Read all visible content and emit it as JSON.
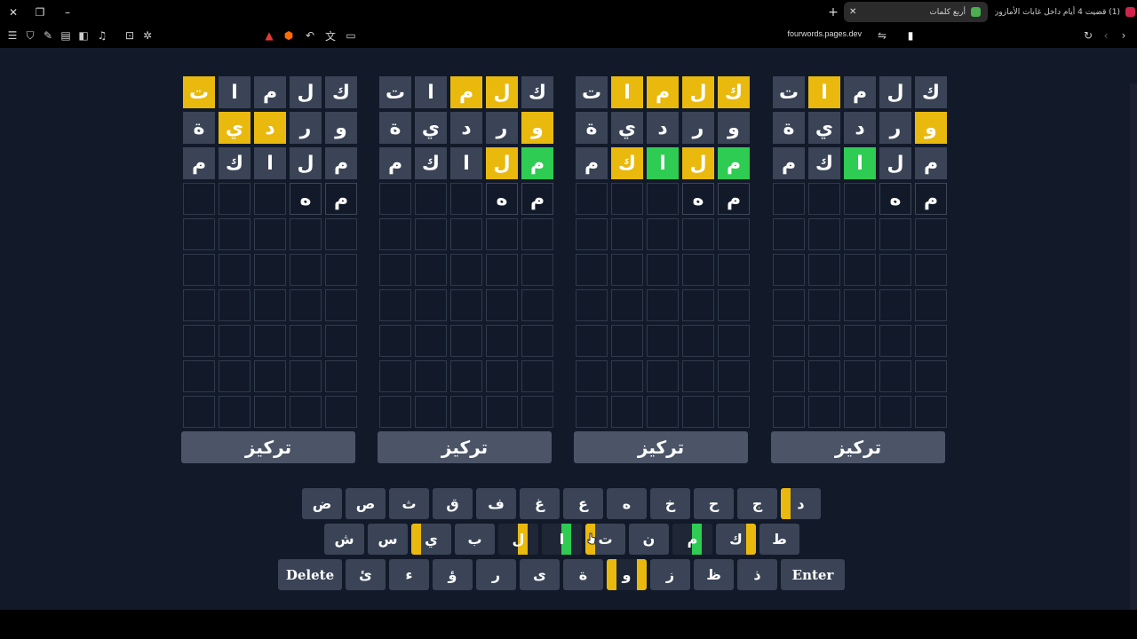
{
  "browser": {
    "tabs": [
      {
        "title": "(1) قضيت 4 أيام داخل غابات الأمازون !",
        "active": false,
        "favicon_color": "#d0244a"
      },
      {
        "title": "أربع كلمات",
        "active": true,
        "favicon_color": "#4caf50"
      }
    ],
    "url": "fourwords.pages.dev",
    "new_tab_label": "+"
  },
  "game": {
    "colors": {
      "gray": "#3a4456",
      "yellow": "#e9b90e",
      "green": "#2ecc52",
      "background": "#121a2a"
    },
    "boards": [
      {
        "focus_label": "تركيز",
        "rows": [
          [
            {
              "l": "ك",
              "s": "gray"
            },
            {
              "l": "ل",
              "s": "gray"
            },
            {
              "l": "م",
              "s": "gray"
            },
            {
              "l": "ا",
              "s": "gray"
            },
            {
              "l": "ت",
              "s": "yellow"
            }
          ],
          [
            {
              "l": "و",
              "s": "gray"
            },
            {
              "l": "ر",
              "s": "gray"
            },
            {
              "l": "د",
              "s": "yellow"
            },
            {
              "l": "ي",
              "s": "yellow"
            },
            {
              "l": "ة",
              "s": "gray"
            }
          ],
          [
            {
              "l": "م",
              "s": "gray"
            },
            {
              "l": "ل",
              "s": "gray"
            },
            {
              "l": "ا",
              "s": "gray"
            },
            {
              "l": "ك",
              "s": "gray"
            },
            {
              "l": "م",
              "s": "gray"
            }
          ],
          [
            {
              "l": "م",
              "s": "typed"
            },
            {
              "l": "ه",
              "s": "typed"
            },
            {
              "l": "",
              "s": "empty"
            },
            {
              "l": "",
              "s": "empty"
            },
            {
              "l": "",
              "s": "empty"
            }
          ]
        ]
      },
      {
        "focus_label": "تركيز",
        "rows": [
          [
            {
              "l": "ك",
              "s": "gray"
            },
            {
              "l": "ل",
              "s": "yellow"
            },
            {
              "l": "م",
              "s": "yellow"
            },
            {
              "l": "ا",
              "s": "gray"
            },
            {
              "l": "ت",
              "s": "gray"
            }
          ],
          [
            {
              "l": "و",
              "s": "yellow"
            },
            {
              "l": "ر",
              "s": "gray"
            },
            {
              "l": "د",
              "s": "gray"
            },
            {
              "l": "ي",
              "s": "gray"
            },
            {
              "l": "ة",
              "s": "gray"
            }
          ],
          [
            {
              "l": "م",
              "s": "green"
            },
            {
              "l": "ل",
              "s": "yellow"
            },
            {
              "l": "ا",
              "s": "gray"
            },
            {
              "l": "ك",
              "s": "gray"
            },
            {
              "l": "م",
              "s": "gray"
            }
          ],
          [
            {
              "l": "م",
              "s": "typed"
            },
            {
              "l": "ه",
              "s": "typed"
            },
            {
              "l": "",
              "s": "empty"
            },
            {
              "l": "",
              "s": "empty"
            },
            {
              "l": "",
              "s": "empty"
            }
          ]
        ]
      },
      {
        "focus_label": "تركيز",
        "rows": [
          [
            {
              "l": "ك",
              "s": "yellow"
            },
            {
              "l": "ل",
              "s": "yellow"
            },
            {
              "l": "م",
              "s": "yellow"
            },
            {
              "l": "ا",
              "s": "yellow"
            },
            {
              "l": "ت",
              "s": "gray"
            }
          ],
          [
            {
              "l": "و",
              "s": "gray"
            },
            {
              "l": "ر",
              "s": "gray"
            },
            {
              "l": "د",
              "s": "gray"
            },
            {
              "l": "ي",
              "s": "gray"
            },
            {
              "l": "ة",
              "s": "gray"
            }
          ],
          [
            {
              "l": "م",
              "s": "green"
            },
            {
              "l": "ل",
              "s": "yellow"
            },
            {
              "l": "ا",
              "s": "green"
            },
            {
              "l": "ك",
              "s": "yellow"
            },
            {
              "l": "م",
              "s": "gray"
            }
          ],
          [
            {
              "l": "م",
              "s": "typed"
            },
            {
              "l": "ه",
              "s": "typed"
            },
            {
              "l": "",
              "s": "empty"
            },
            {
              "l": "",
              "s": "empty"
            },
            {
              "l": "",
              "s": "empty"
            }
          ]
        ]
      },
      {
        "focus_label": "تركيز",
        "rows": [
          [
            {
              "l": "ك",
              "s": "gray"
            },
            {
              "l": "ل",
              "s": "gray"
            },
            {
              "l": "م",
              "s": "gray"
            },
            {
              "l": "ا",
              "s": "yellow"
            },
            {
              "l": "ت",
              "s": "gray"
            }
          ],
          [
            {
              "l": "و",
              "s": "yellow"
            },
            {
              "l": "ر",
              "s": "gray"
            },
            {
              "l": "د",
              "s": "gray"
            },
            {
              "l": "ي",
              "s": "gray"
            },
            {
              "l": "ة",
              "s": "gray"
            }
          ],
          [
            {
              "l": "م",
              "s": "gray"
            },
            {
              "l": "ل",
              "s": "gray"
            },
            {
              "l": "ا",
              "s": "green"
            },
            {
              "l": "ك",
              "s": "gray"
            },
            {
              "l": "م",
              "s": "gray"
            }
          ],
          [
            {
              "l": "م",
              "s": "typed"
            },
            {
              "l": "ه",
              "s": "typed"
            },
            {
              "l": "",
              "s": "empty"
            },
            {
              "l": "",
              "s": "empty"
            },
            {
              "l": "",
              "s": "empty"
            }
          ]
        ]
      }
    ],
    "total_rows": 10,
    "keyboard": [
      [
        {
          "l": "ض"
        },
        {
          "l": "ص"
        },
        {
          "l": "ث"
        },
        {
          "l": "ق"
        },
        {
          "l": "ف"
        },
        {
          "l": "غ"
        },
        {
          "l": "ع"
        },
        {
          "l": "ه"
        },
        {
          "l": "خ"
        },
        {
          "l": "ح"
        },
        {
          "l": "ج"
        },
        {
          "l": "د",
          "bars": [
            {
              "pos": "left",
              "c": "yellow"
            }
          ]
        }
      ],
      [
        {
          "l": "ش"
        },
        {
          "l": "س"
        },
        {
          "l": "ي",
          "bars": [
            {
              "pos": "left",
              "c": "yellow"
            }
          ]
        },
        {
          "l": "ب"
        },
        {
          "l": "ل",
          "bars": [
            {
              "pos": "mid",
              "c": "yellow"
            }
          ],
          "dark": true
        },
        {
          "l": "ا",
          "bars": [
            {
              "pos": "mid",
              "c": "green"
            }
          ],
          "dark": true
        },
        {
          "l": "ت",
          "bars": [
            {
              "pos": "left",
              "c": "yellow"
            }
          ]
        },
        {
          "l": "ن"
        },
        {
          "l": "م",
          "bars": [
            {
              "pos": "mid",
              "c": "green"
            }
          ],
          "dark": true
        },
        {
          "l": "ك",
          "bars": [
            {
              "pos": "right",
              "c": "yellow"
            }
          ]
        },
        {
          "l": "ط"
        }
      ],
      [
        {
          "l": "Delete",
          "wide": true
        },
        {
          "l": "ئ"
        },
        {
          "l": "ء"
        },
        {
          "l": "ؤ"
        },
        {
          "l": "ر"
        },
        {
          "l": "ى"
        },
        {
          "l": "ة"
        },
        {
          "l": "و",
          "bars": [
            {
              "pos": "left",
              "c": "yellow"
            },
            {
              "pos": "right",
              "c": "yellow"
            }
          ],
          "dark": true
        },
        {
          "l": "ز"
        },
        {
          "l": "ظ"
        },
        {
          "l": "ذ"
        },
        {
          "l": "Enter",
          "wide": true
        }
      ]
    ]
  }
}
